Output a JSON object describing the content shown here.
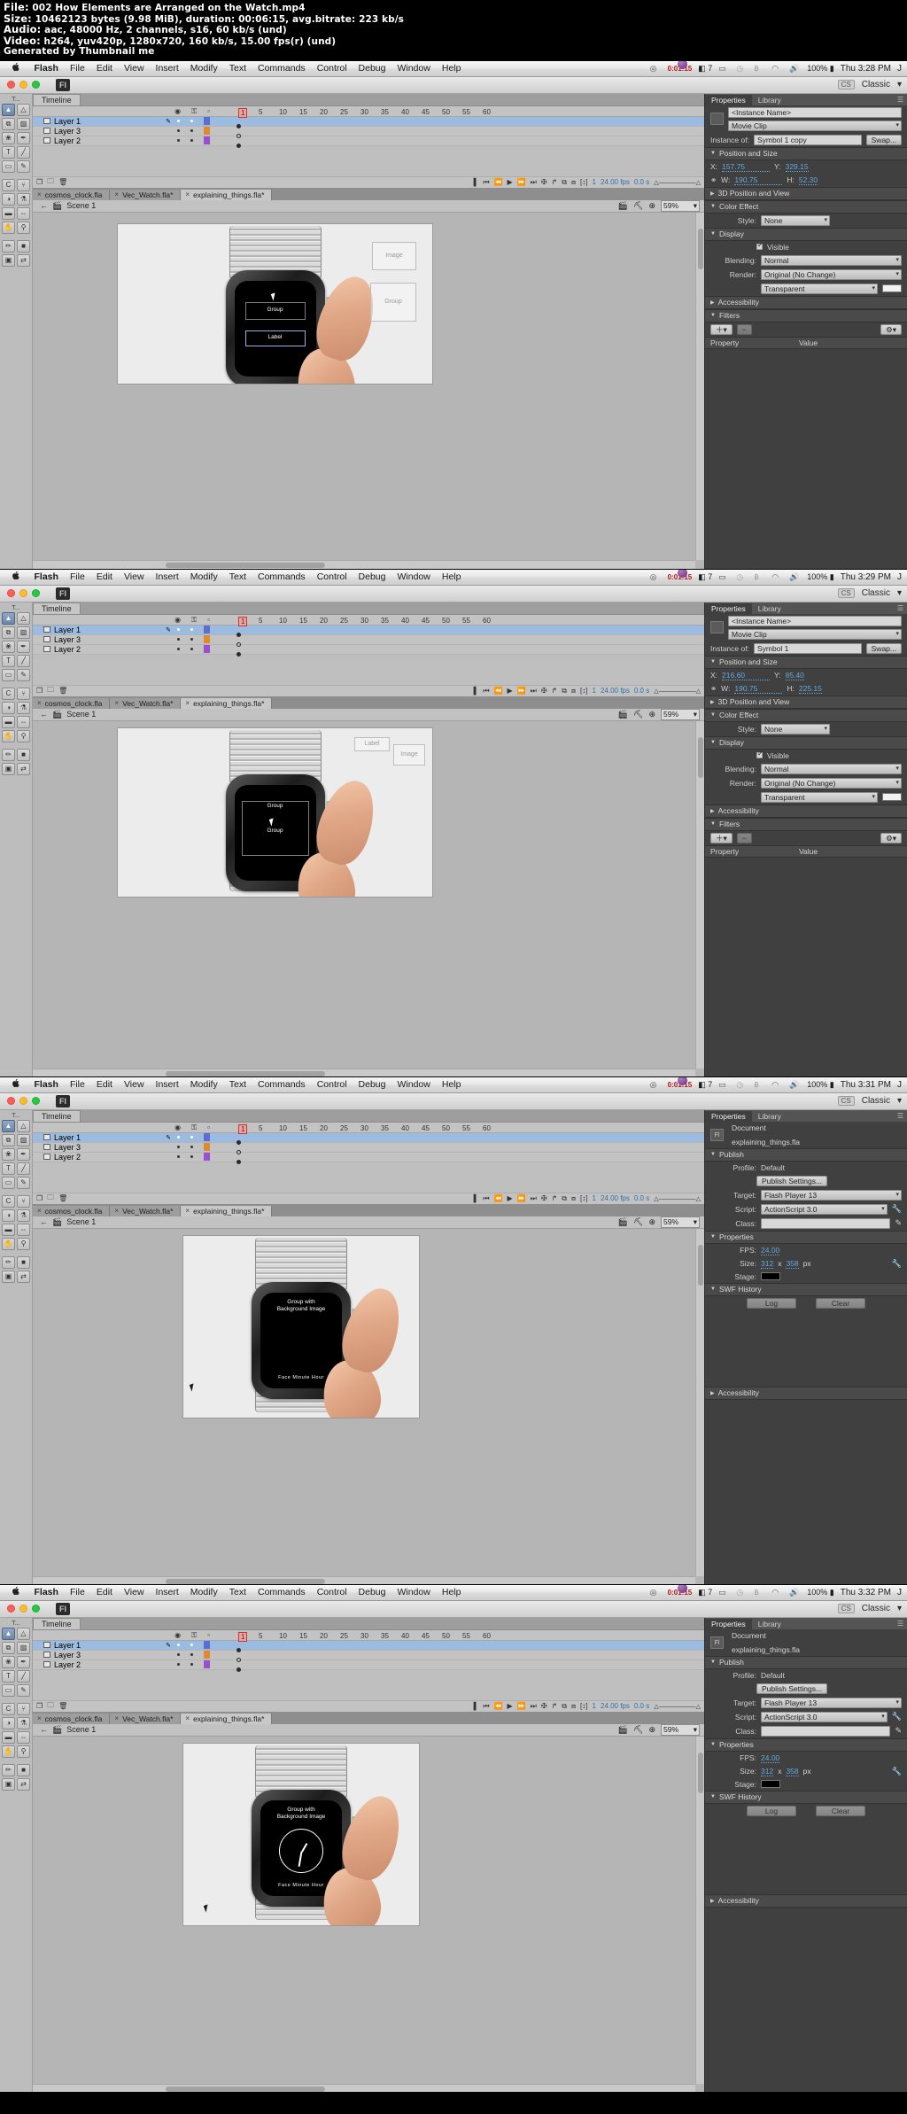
{
  "meta": {
    "file_label": "File:",
    "file_value": "002 How Elements are Arranged on the Watch.mp4",
    "size_label": "Size:",
    "size_value": "10462123 bytes (9.98 MiB), duration: 00:06:15, avg.bitrate: 223 kb/s",
    "audio_label": "Audio:",
    "audio_value": "aac, 48000 Hz, 2 channels, s16, 60 kb/s (und)",
    "video_label": "Video:",
    "video_value": "h264, yuv420p, 1280x720, 160 kb/s, 15.00 fps(r) (und)",
    "generated": "Generated by Thumbnail me"
  },
  "menubar": {
    "apple": "",
    "items": [
      "Flash",
      "File",
      "Edit",
      "View",
      "Insert",
      "Modify",
      "Text",
      "Commands",
      "Control",
      "Debug",
      "Window",
      "Help"
    ],
    "cc_time": "0:01:15",
    "app_count": "7",
    "battery": "100%",
    "user_initial": "J"
  },
  "app": {
    "title": "Fl",
    "workspace": "Classic",
    "workspace_arrow": "▾",
    "cs_badge": "CS"
  },
  "timeline": {
    "tab": "Timeline",
    "head_icons": [
      "eye-icon",
      "lock-icon",
      "outline-icon"
    ],
    "ruler_ticks": [
      "1",
      "5",
      "10",
      "15",
      "20",
      "25",
      "30",
      "35",
      "40",
      "45",
      "50",
      "55",
      "60"
    ],
    "fps": "24.00 fps",
    "elapsed": "0.0 s",
    "current_frame": "1",
    "onion_tools": [
      "new-layer-icon",
      "new-folder-icon",
      "delete-layer-icon"
    ],
    "transport": [
      "go-to-first-icon",
      "step-back-icon",
      "play-icon",
      "step-forward-icon",
      "go-to-last-icon",
      "center-frame-icon",
      "loop-icon",
      "onion-skin-icon",
      "onion-outline-icon",
      "edit-multiple-icon",
      "modify-markers-icon"
    ]
  },
  "frames": [
    {
      "id": "frame-1",
      "clock": "Thu 3:28 PM",
      "layers": [
        {
          "name": "Layer 1",
          "selected": true,
          "color": "#5c6fd0"
        },
        {
          "name": "Layer 3",
          "selected": false,
          "color": "#e08a30"
        },
        {
          "name": "Layer 2",
          "selected": false,
          "color": "#9b4fd0"
        }
      ],
      "doc_tabs": [
        {
          "label": "cosmos_clock.fla",
          "active": false
        },
        {
          "label": "Vec_Watch.fla*",
          "active": false
        },
        {
          "label": "explaining_things.fla*",
          "active": true
        }
      ],
      "scene": "Scene 1",
      "zoom": "59%",
      "stage_labels": {
        "group": "Group",
        "label": "Label"
      },
      "ghosts": [
        {
          "text": "Image"
        },
        {
          "text": "Group"
        }
      ],
      "properties": {
        "tabs": [
          {
            "label": "Properties",
            "active": true
          },
          {
            "label": "Library",
            "active": false
          }
        ],
        "kind": "symbol",
        "instance_name": "<Instance Name>",
        "symbol_type": "Movie Clip",
        "instance_of_label": "Instance of:",
        "instance_of_value": "Symbol 1 copy",
        "swap_label": "Swap...",
        "sections": {
          "position_and_size": "Position and Size",
          "three_d": "3D Position and View",
          "color_effect": "Color Effect",
          "display": "Display",
          "accessibility": "Accessibility",
          "filters": "Filters"
        },
        "x_label": "X:",
        "x_value": "157.75",
        "y_label": "Y:",
        "y_value": "329.15",
        "w_label": "W:",
        "w_value": "190.75",
        "h_label": "H:",
        "h_value": "52.30",
        "style_label": "Style:",
        "style_value": "None",
        "visible_label": "Visible",
        "blending_label": "Blending:",
        "blending_value": "Normal",
        "render_label": "Render:",
        "render_value": "Original (No Change)",
        "transparent_label": "Transparent",
        "filters_property": "Property",
        "filters_value": "Value"
      }
    },
    {
      "id": "frame-2",
      "clock": "Thu 3:29 PM",
      "layers": [
        {
          "name": "Layer 1",
          "selected": true,
          "color": "#5c6fd0"
        },
        {
          "name": "Layer 3",
          "selected": false,
          "color": "#e08a30"
        },
        {
          "name": "Layer 2",
          "selected": false,
          "color": "#9b4fd0"
        }
      ],
      "doc_tabs": [
        {
          "label": "cosmos_clock.fla",
          "active": false
        },
        {
          "label": "Vec_Watch.fla*",
          "active": false
        },
        {
          "label": "explaining_things.fla*",
          "active": true
        }
      ],
      "scene": "Scene 1",
      "zoom": "59%",
      "stage_labels": {
        "group": "Group",
        "group2": "Group"
      },
      "ghosts": [
        {
          "text": "Label"
        },
        {
          "text": "Image"
        }
      ],
      "properties": {
        "tabs": [
          {
            "label": "Properties",
            "active": true
          },
          {
            "label": "Library",
            "active": false
          }
        ],
        "kind": "symbol",
        "instance_name": "<Instance Name>",
        "symbol_type": "Movie Clip",
        "instance_of_label": "Instance of:",
        "instance_of_value": "Symbol 1",
        "swap_label": "Swap...",
        "sections": {
          "position_and_size": "Position and Size",
          "three_d": "3D Position and View",
          "color_effect": "Color Effect",
          "display": "Display",
          "accessibility": "Accessibility",
          "filters": "Filters"
        },
        "x_label": "X:",
        "x_value": "216.60",
        "y_label": "Y:",
        "y_value": "85.40",
        "w_label": "W:",
        "w_value": "190.75",
        "h_label": "H:",
        "h_value": "225.15",
        "style_label": "Style:",
        "style_value": "None",
        "visible_label": "Visible",
        "blending_label": "Blending:",
        "blending_value": "Normal",
        "render_label": "Render:",
        "render_value": "Original (No Change)",
        "transparent_label": "Transparent",
        "filters_property": "Property",
        "filters_value": "Value"
      }
    },
    {
      "id": "frame-3",
      "clock": "Thu 3:31 PM",
      "layers": [
        {
          "name": "Layer 1",
          "selected": true,
          "color": "#5c6fd0"
        },
        {
          "name": "Layer 3",
          "selected": false,
          "color": "#e08a30"
        },
        {
          "name": "Layer 2",
          "selected": false,
          "color": "#9b4fd0"
        }
      ],
      "doc_tabs": [
        {
          "label": "cosmos_clock.fla",
          "active": false
        },
        {
          "label": "Vec_Watch.fla*",
          "active": false
        },
        {
          "label": "explaining_things.fla*",
          "active": true
        }
      ],
      "scene": "Scene 1",
      "zoom": "59%",
      "stage_labels": {
        "title1": "Group with",
        "title2": "Background Image",
        "footer": "Face  Minute  Hour"
      },
      "properties": {
        "tabs": [
          {
            "label": "Properties",
            "active": true
          },
          {
            "label": "Library",
            "active": false
          }
        ],
        "kind": "document",
        "doc_label": "Document",
        "doc_name": "explaining_things.fla",
        "sections": {
          "publish": "Publish",
          "properties": "Properties",
          "swf_history": "SWF History",
          "accessibility": "Accessibility"
        },
        "profile_label": "Profile:",
        "profile_value": "Default",
        "publish_settings": "Publish Settings...",
        "target_label": "Target:",
        "target_value": "Flash Player 13",
        "script_label": "Script:",
        "script_value": "ActionScript 3.0",
        "class_label": "Class:",
        "class_value": "",
        "fps_label": "FPS:",
        "fps_value": "24.00",
        "size_label": "Size:",
        "size_w": "312",
        "size_x": "x",
        "size_h": "358",
        "size_unit": "px",
        "stage_label": "Stage:",
        "log_label": "Log",
        "clear_label": "Clear"
      }
    },
    {
      "id": "frame-4",
      "clock": "Thu 3:32 PM",
      "layers": [
        {
          "name": "Layer 1",
          "selected": true,
          "color": "#5c6fd0"
        },
        {
          "name": "Layer 3",
          "selected": false,
          "color": "#e08a30"
        },
        {
          "name": "Layer 2",
          "selected": false,
          "color": "#9b4fd0"
        }
      ],
      "doc_tabs": [
        {
          "label": "cosmos_clock.fla",
          "active": false
        },
        {
          "label": "Vec_Watch.fla*",
          "active": false
        },
        {
          "label": "explaining_things.fla*",
          "active": true
        }
      ],
      "scene": "Scene 1",
      "zoom": "59%",
      "stage_labels": {
        "title1": "Group with",
        "title2": "Background Image",
        "footer": "Face  Minute  Hour"
      },
      "properties": {
        "tabs": [
          {
            "label": "Properties",
            "active": true
          },
          {
            "label": "Library",
            "active": false
          }
        ],
        "kind": "document",
        "doc_label": "Document",
        "doc_name": "explaining_things.fla",
        "sections": {
          "publish": "Publish",
          "properties": "Properties",
          "swf_history": "SWF History",
          "accessibility": "Accessibility"
        },
        "profile_label": "Profile:",
        "profile_value": "Default",
        "publish_settings": "Publish Settings...",
        "target_label": "Target:",
        "target_value": "Flash Player 13",
        "script_label": "Script:",
        "script_value": "ActionScript 3.0",
        "class_label": "Class:",
        "class_value": "",
        "fps_label": "FPS:",
        "fps_value": "24.00",
        "size_label": "Size:",
        "size_w": "312",
        "size_x": "x",
        "size_h": "358",
        "size_unit": "px",
        "stage_label": "Stage:",
        "log_label": "Log",
        "clear_label": "Clear"
      }
    }
  ],
  "tools": {
    "groups": [
      [
        "selection-tool",
        "subselection-tool"
      ],
      [
        "free-transform-tool",
        "gradient-transform-tool"
      ],
      [
        "lasso-tool",
        "pen-tool"
      ],
      [
        "text-tool",
        "line-tool"
      ],
      [
        "rectangle-tool",
        "pencil-tool"
      ],
      [
        "brush-tool",
        "bone-tool"
      ],
      [
        "paint-bucket-tool",
        "eyedropper-tool"
      ],
      [
        "eraser-tool",
        "width-tool"
      ],
      [
        "hand-tool",
        "zoom-tool"
      ],
      [
        "stroke-color",
        "fill-color"
      ],
      [
        "black-white-swatch",
        "swap-colors"
      ]
    ]
  }
}
